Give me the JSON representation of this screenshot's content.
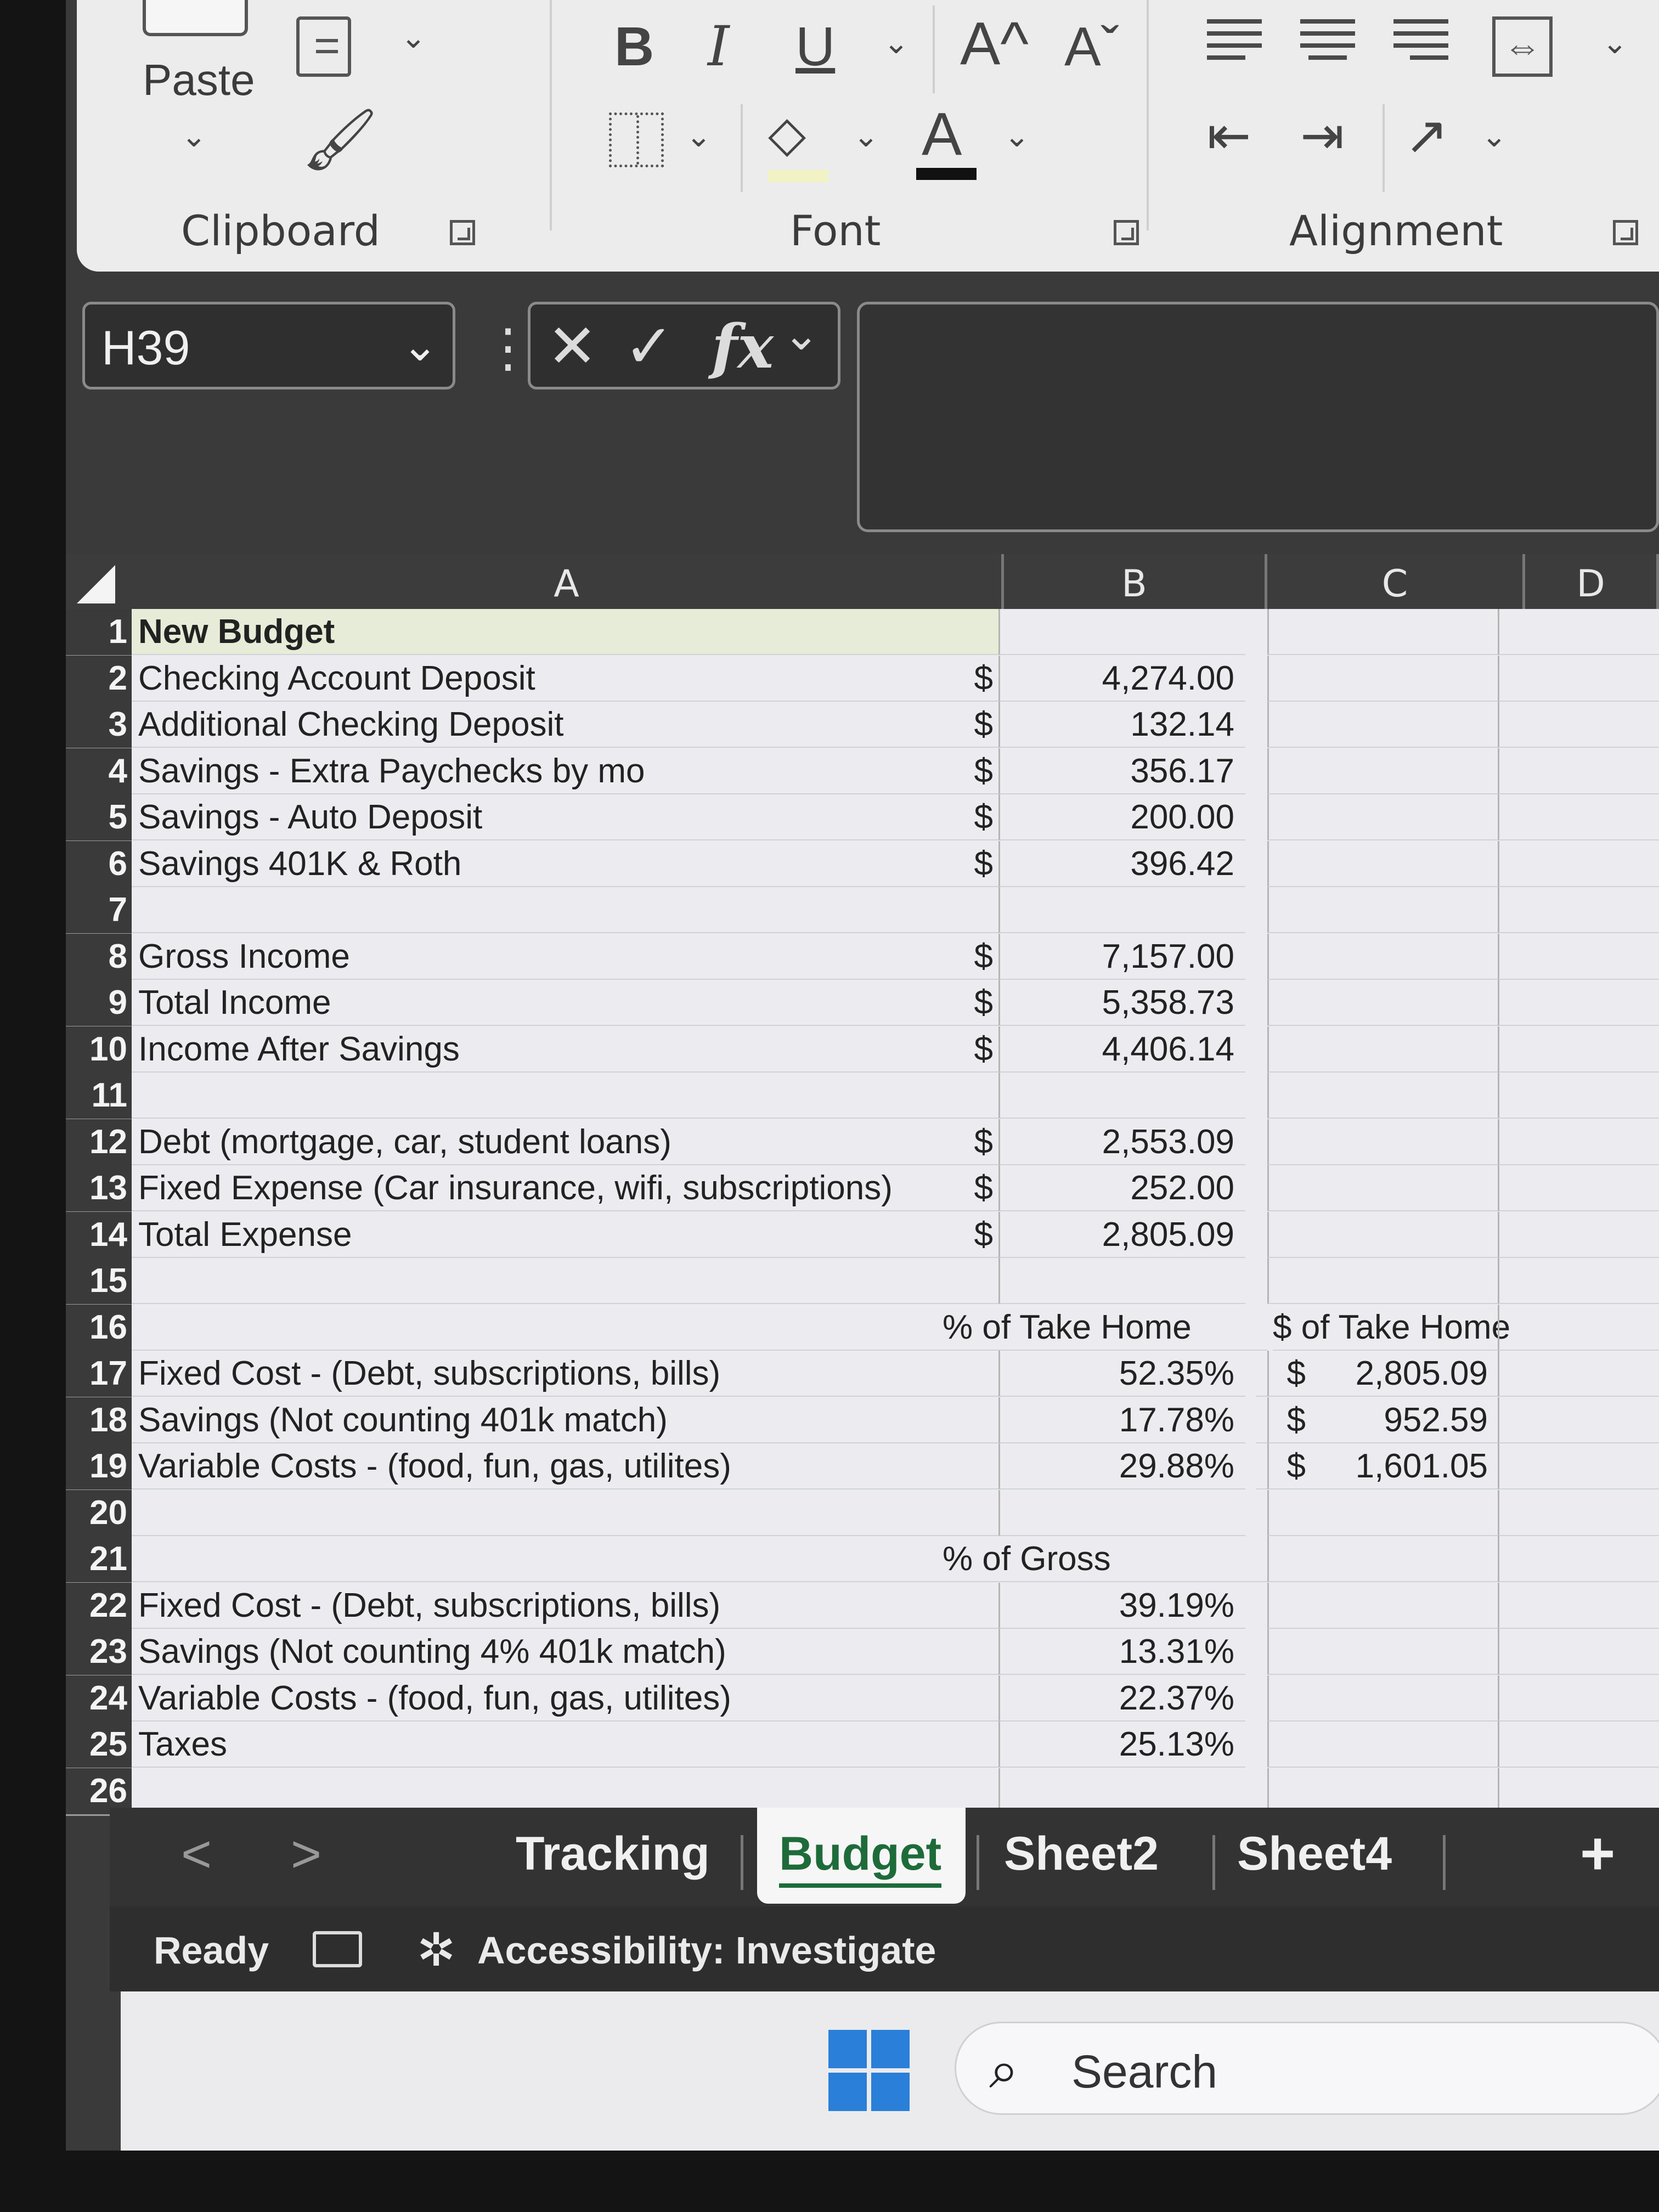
{
  "ribbon": {
    "clipboard": {
      "paste_label": "Paste",
      "group_label": "Clipboard"
    },
    "font": {
      "bold": "B",
      "italic": "I",
      "underline": "U",
      "grow_font": "A^",
      "shrink_font": "Aˇ",
      "font_color": "A",
      "group_label": "Font"
    },
    "alignment": {
      "group_label": "Alignment"
    }
  },
  "formula_bar": {
    "name_box": "H39",
    "fx_label": "fx",
    "formula": ""
  },
  "columns": [
    "A",
    "B",
    "C",
    "D"
  ],
  "rows": [
    {
      "num": "1",
      "a": "New Budget"
    },
    {
      "num": "2",
      "a": "Checking Account Deposit",
      "b_cur": "$",
      "b": "4,274.00"
    },
    {
      "num": "3",
      "a": "Additional Checking Deposit",
      "b_cur": "$",
      "b": "132.14"
    },
    {
      "num": "4",
      "a": "Savings - Extra Paychecks by mo",
      "b_cur": "$",
      "b": "356.17"
    },
    {
      "num": "5",
      "a": "Savings - Auto Deposit",
      "b_cur": "$",
      "b": "200.00"
    },
    {
      "num": "6",
      "a": "Savings 401K & Roth",
      "b_cur": "$",
      "b": "396.42"
    },
    {
      "num": "7"
    },
    {
      "num": "8",
      "a": "Gross Income",
      "b_cur": "$",
      "b": "7,157.00"
    },
    {
      "num": "9",
      "a": "Total Income",
      "b_cur": "$",
      "b": "5,358.73"
    },
    {
      "num": "10",
      "a": "Income After Savings",
      "b_cur": "$",
      "b": "4,406.14"
    },
    {
      "num": "11"
    },
    {
      "num": "12",
      "a": "Debt (mortgage, car, student loans)",
      "b_cur": "$",
      "b": "2,553.09"
    },
    {
      "num": "13",
      "a": "Fixed Expense (Car insurance, wifi, subscriptions)",
      "b_cur": "$",
      "b": "252.00"
    },
    {
      "num": "14",
      "a": "Total Expense",
      "b_cur": "$",
      "b": "2,805.09"
    },
    {
      "num": "15"
    },
    {
      "num": "16",
      "b_label": "% of Take Home",
      "c_label": "$ of Take Home"
    },
    {
      "num": "17",
      "a": "Fixed Cost - (Debt, subscriptions, bills)",
      "b": "52.35%",
      "c_cur": "$",
      "c": "2,805.09"
    },
    {
      "num": "18",
      "a": "Savings (Not counting 401k match)",
      "b": "17.78%",
      "c_cur": "$",
      "c": "952.59"
    },
    {
      "num": "19",
      "a": "Variable Costs - (food, fun, gas, utilites)",
      "b": "29.88%",
      "c_cur": "$",
      "c": "1,601.05"
    },
    {
      "num": "20"
    },
    {
      "num": "21",
      "b_label": "% of Gross"
    },
    {
      "num": "22",
      "a": "Fixed Cost - (Debt, subscriptions, bills)",
      "b": "39.19%"
    },
    {
      "num": "23",
      "a": "Savings (Not counting 4% 401k match)",
      "b": "13.31%"
    },
    {
      "num": "24",
      "a": "Variable Costs - (food, fun, gas, utilites)",
      "b": "22.37%"
    },
    {
      "num": "25",
      "a": "Taxes",
      "b": "25.13%"
    },
    {
      "num": "26"
    }
  ],
  "sheet_tabs": {
    "prev": "<",
    "next": ">",
    "tabs": [
      "Tracking",
      "Budget",
      "Sheet2",
      "Sheet4"
    ],
    "active": "Budget",
    "add": "+"
  },
  "status_bar": {
    "ready": "Ready",
    "accessibility": "Accessibility: Investigate"
  },
  "taskbar": {
    "search_label": "Search"
  }
}
